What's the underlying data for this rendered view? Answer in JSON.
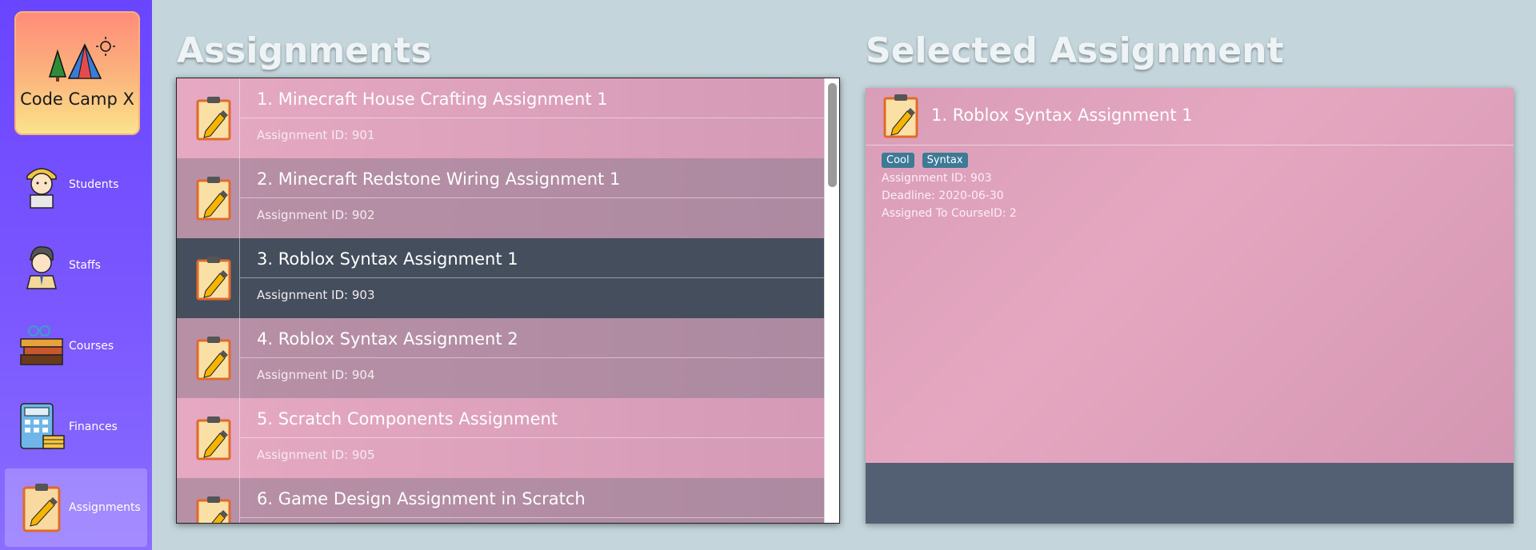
{
  "logo": {
    "text": "Code Camp X"
  },
  "nav": [
    {
      "label": "Students",
      "icon": "student-icon"
    },
    {
      "label": "Staffs",
      "icon": "staff-icon"
    },
    {
      "label": "Courses",
      "icon": "courses-icon"
    },
    {
      "label": "Finances",
      "icon": "finances-icon"
    },
    {
      "label": "Assignments",
      "icon": "assignment-icon",
      "active": true
    }
  ],
  "list": {
    "heading": "Assignments",
    "items": [
      {
        "title": "1. Minecraft House Crafting Assignment 1",
        "sub": "Assignment ID: 901"
      },
      {
        "title": "2. Minecraft Redstone Wiring Assignment 1",
        "sub": "Assignment ID: 902"
      },
      {
        "title": "3. Roblox Syntax Assignment 1",
        "sub": "Assignment ID: 903",
        "selected": true
      },
      {
        "title": "4. Roblox Syntax Assignment 2",
        "sub": "Assignment ID: 904"
      },
      {
        "title": "5. Scratch Components Assignment",
        "sub": "Assignment ID: 905"
      },
      {
        "title": "6. Game Design Assignment in Scratch",
        "sub": ""
      }
    ]
  },
  "detail": {
    "heading": "Selected Assignment",
    "title": "1.  Roblox Syntax Assignment 1",
    "tags": [
      "Cool",
      "Syntax"
    ],
    "assignment_id": "Assignment ID: 903",
    "deadline": "Deadline: 2020-06-30",
    "course": "Assigned To CourseID: 2"
  },
  "colors": {
    "sidebar": "#6a45ff",
    "selected_row": "#444e5c",
    "tag": "#3d7a96",
    "background": "#c4d6dc"
  }
}
